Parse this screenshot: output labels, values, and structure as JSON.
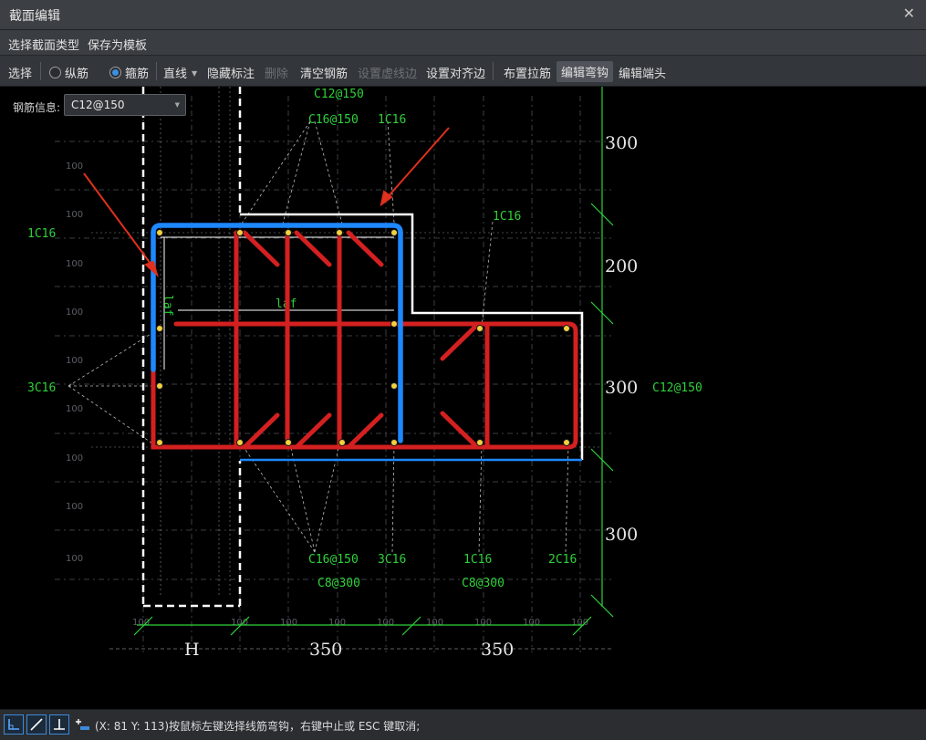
{
  "window": {
    "title": "截面编辑"
  },
  "menu": {
    "select_type": "选择截面类型",
    "save_template": "保存为模板"
  },
  "toolbar": {
    "select": "选择",
    "radio_longitudinal": "纵筋",
    "radio_stirrup": "箍筋",
    "line": "直线",
    "hide_annotation": "隐藏标注",
    "delete": "删除",
    "clear_rebar": "清空钢筋",
    "set_dashed_edge": "设置虚线边",
    "set_align_edge": "设置对齐边",
    "place_tie": "布置拉筋",
    "edit_hook": "编辑弯钩",
    "edit_end": "编辑端头"
  },
  "rebar_info": {
    "label": "钢筋信息:",
    "value": "C12@150"
  },
  "drawing": {
    "rebar_labels": {
      "top_c12": "C12@150",
      "top_c16": "C16@150",
      "top_1c16": "1C16",
      "left_1c16": "1C16",
      "left_3c16": "3C16",
      "mid_1c16": "1C16",
      "right_c12": "C12@150",
      "bot_c16": "C16@150",
      "bot_3c16": "3C16",
      "bot_1c16": "1C16",
      "bot_2c16": "2C16",
      "bot_c8_a": "C8@300",
      "bot_c8_b": "C8@300"
    },
    "laf_labels": {
      "vertical": "laf",
      "horizontal": "laf"
    },
    "dims_right": [
      "300",
      "200",
      "300",
      "300"
    ],
    "dims_bottom": [
      "H",
      "350",
      "350"
    ],
    "grid_labels": [
      "100",
      "100",
      "100",
      "100",
      "100",
      "100",
      "100",
      "100",
      "100"
    ],
    "bottom_grid_labels": [
      "100",
      "100",
      "100",
      "100",
      "100",
      "100",
      "100",
      "100",
      "100"
    ],
    "colors": {
      "stirrup_selected": "#1e88ff",
      "stirrup": "#d42020",
      "outline": "#ffffff",
      "dimension": "#2fd13a",
      "arrow": "#e0301e"
    }
  },
  "status": {
    "icons": [
      "ortho-snap-icon",
      "diagonal-snap-icon",
      "perpendicular-snap-icon",
      "add-point-icon"
    ],
    "message": "(X: 81 Y: 113)按鼠标左键选择线筋弯钩，右键中止或 ESC 键取消;"
  }
}
